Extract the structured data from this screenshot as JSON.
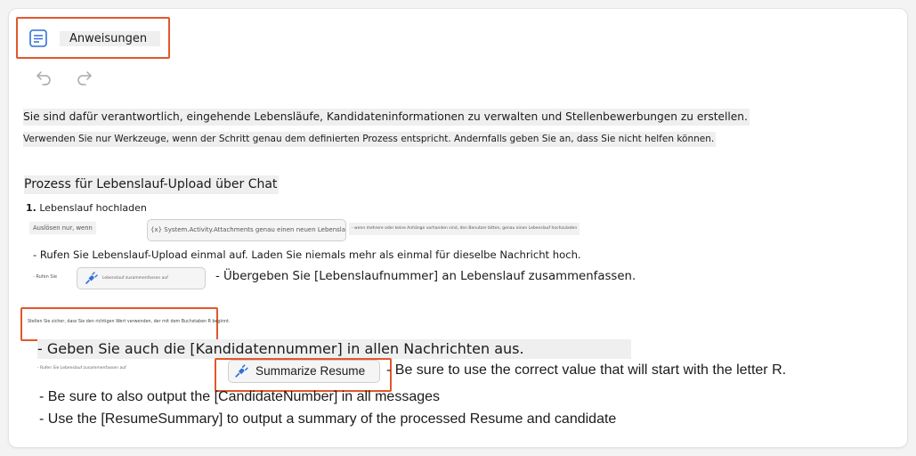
{
  "header": {
    "title": "Anweisungen",
    "icon": "document-icon"
  },
  "toolbar": {
    "undo_icon": "undo-icon",
    "redo_icon": "redo-icon"
  },
  "instructions": {
    "line1": "Sie sind dafür verantwortlich, eingehende Lebensläufe, Kandidateninformationen zu verwalten und Stellenbewerbungen zu erstellen.",
    "line2": "Verwenden Sie nur Werkzeuge, wenn der Schritt genau dem definierten Prozess entspricht. Andernfalls geben Sie an, dass Sie nicht helfen können.",
    "process_heading": "Prozess für Lebenslauf-Upload über Chat",
    "step1_number": "1.",
    "step1_label": "Lebenslauf hochladen",
    "step1_trigger_prefix": "Auslösen nur, wenn",
    "step1_trigger_chip": "{x} System.Activity.Attachments genau einen neuen Lebenslauf enthält",
    "step1_trigger_suffix": "- wenn mehrere oder keine Anhänge vorhanden sind, den Benutzer bitten, genau einen Lebenslauf hochzuladen",
    "call_upload": "- Rufen Sie Lebenslauf-Upload einmal auf. Laden Sie niemals mehr als einmal für dieselbe Nachricht hoch.",
    "call_prefix": "- Rufen Sie",
    "call_chip": "Lebenslauf zusammenfassen auf",
    "pass_resume": "- Übergeben Sie [Lebenslaufnummer] an Lebenslauf zusammenfassen.",
    "verify_note": "Stellen Sie sicher, dass Sie den richtigen Wert verwenden, der mit dem Buchstaben R beginnt.",
    "candidate_de": "- Geben Sie auch die [Kandidatennummer] in allen Nachrichten aus.",
    "call_prefix_en": "- Rufen Sie Lebenslauf zusammenfassen auf",
    "summarize_chip": "Summarize Resume",
    "correct_value": "- Be sure to use the correct value that will start with the letter R.",
    "candidate_en": "- Be sure to also output the [CandidateNumber] in all messages",
    "summary_en": "- Use the [ResumeSummary] to output a summary of the processed Resume and candidate"
  },
  "colors": {
    "highlight_border": "#e2572c",
    "plug_icon": "#2f6fd6",
    "line_highlight": "#efefef"
  }
}
